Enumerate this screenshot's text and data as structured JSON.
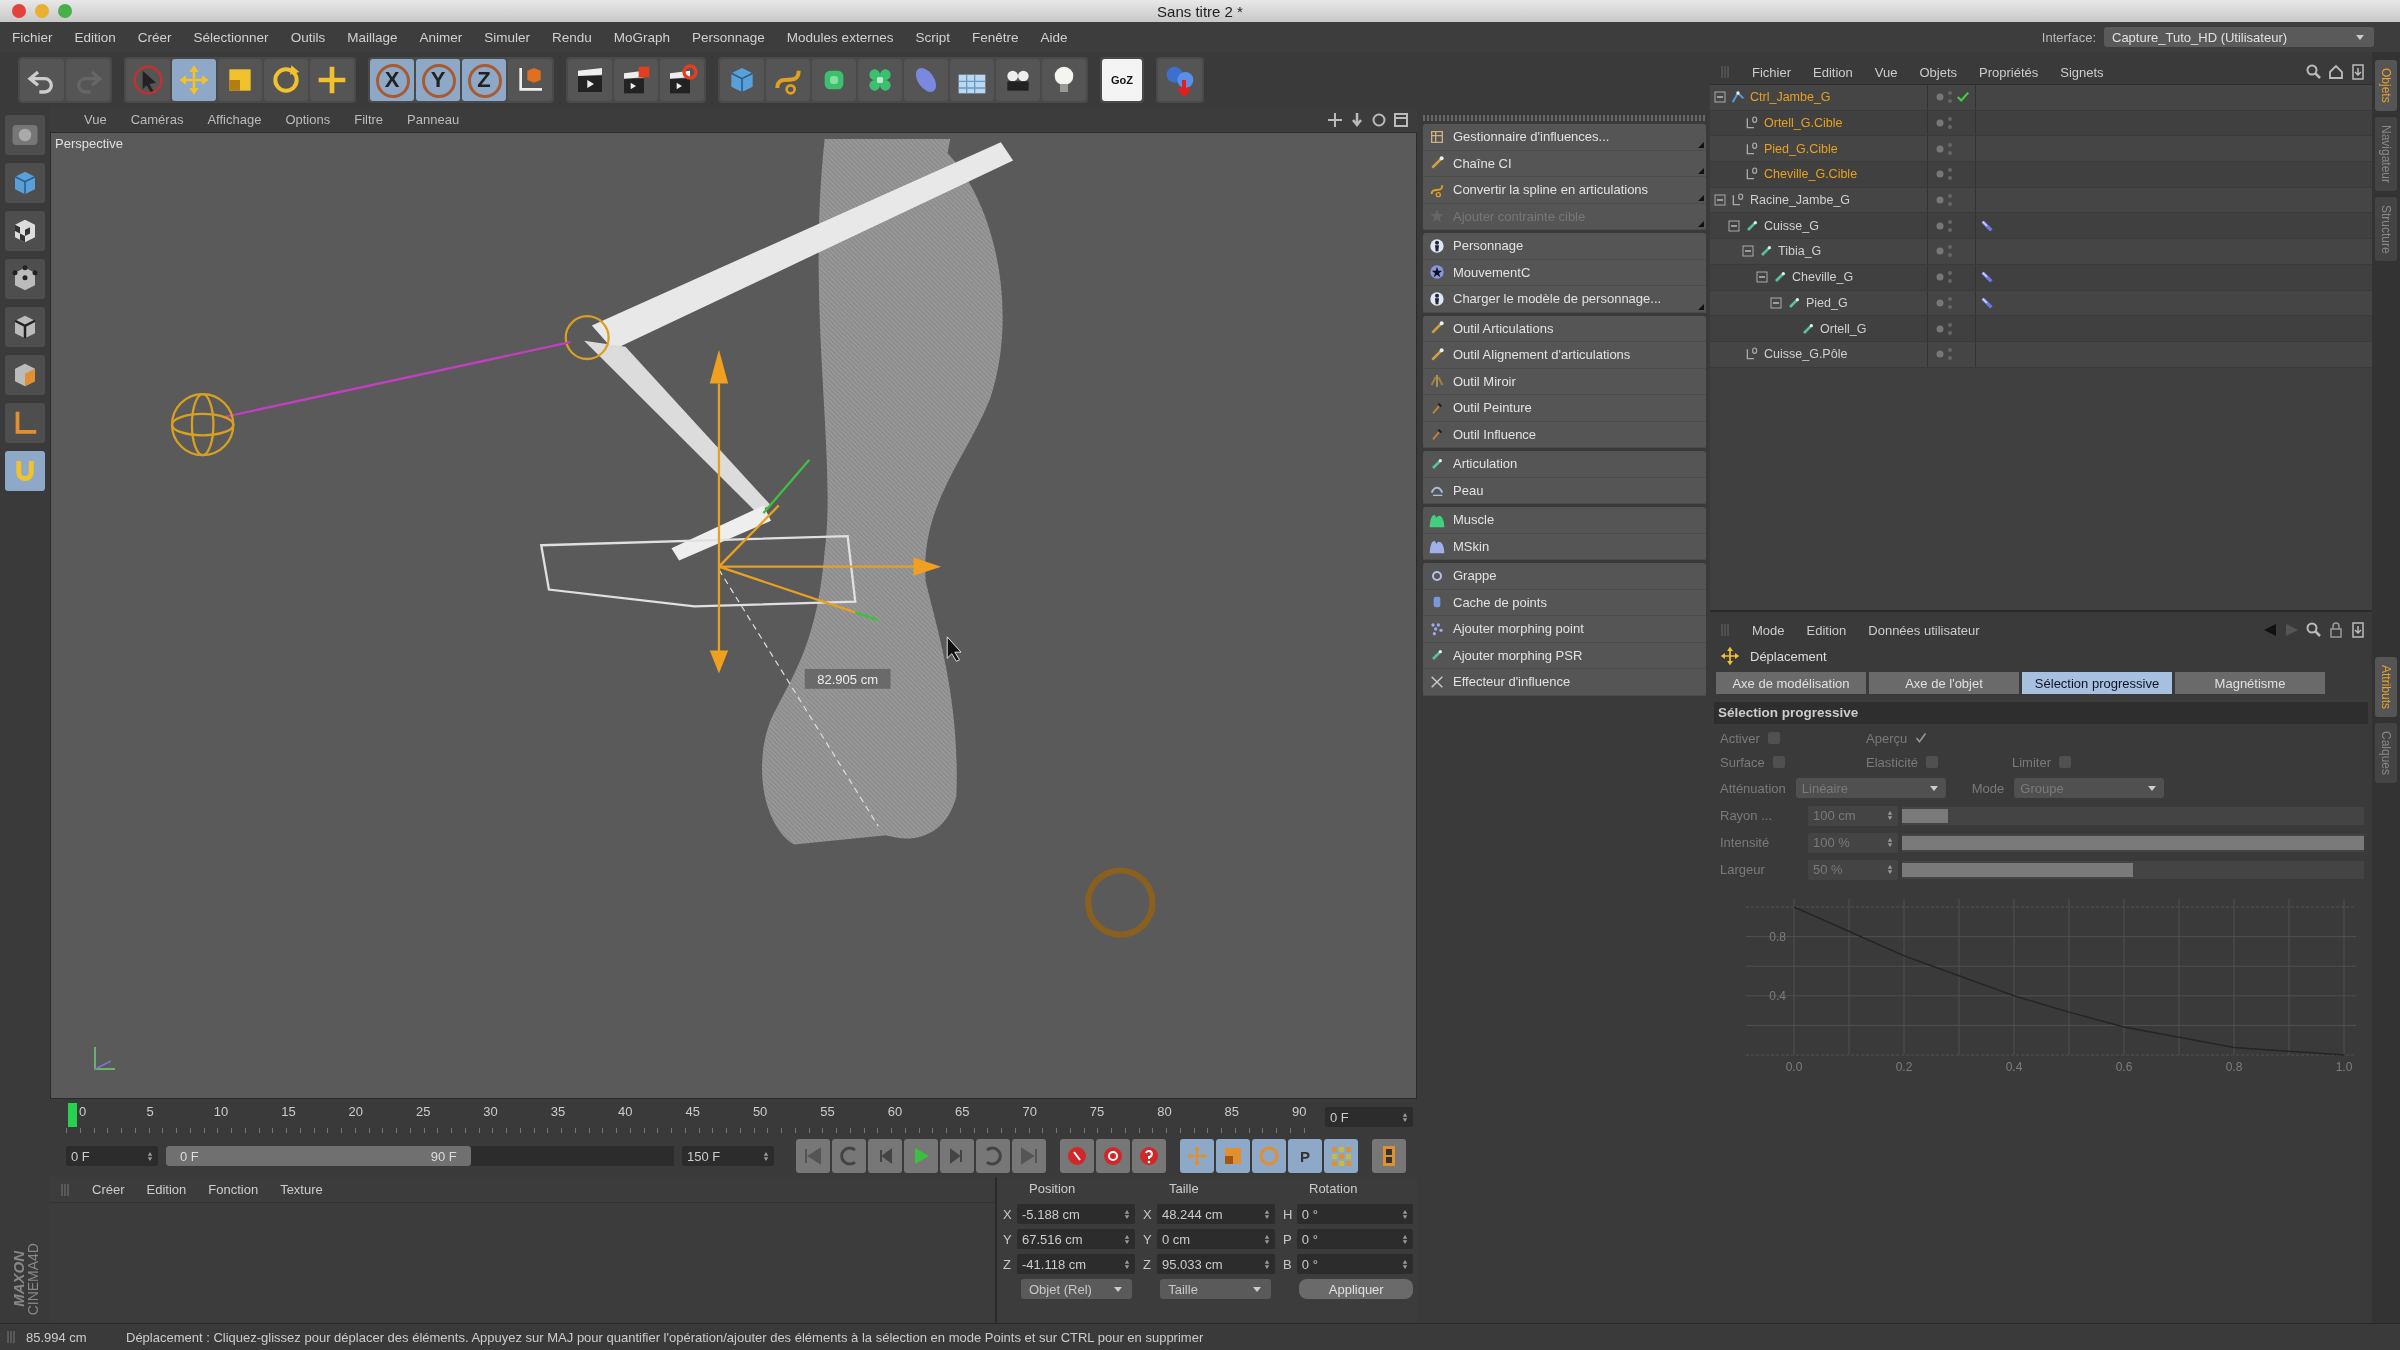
{
  "window": {
    "title": "Sans titre 2 *"
  },
  "menu_bar": {
    "items": [
      "Fichier",
      "Edition",
      "Créer",
      "Sélectionner",
      "Outils",
      "Maillage",
      "Animer",
      "Simuler",
      "Rendu",
      "MoGraph",
      "Personnage",
      "Modules externes",
      "Script",
      "Fenêtre",
      "Aide"
    ],
    "interface_label": "Interface:",
    "interface_value": "Capture_Tuto_HD (Utilisateur)"
  },
  "toolbar": {
    "groups": [
      [
        {
          "kind": "undo",
          "selected": false
        },
        {
          "kind": "redo",
          "selected": false
        }
      ],
      [
        {
          "kind": "pointer",
          "selected": false
        },
        {
          "kind": "move",
          "selected": true
        },
        {
          "kind": "scale",
          "selected": false
        },
        {
          "kind": "rotate",
          "selected": false
        },
        {
          "kind": "plus",
          "selected": false
        }
      ],
      [
        {
          "kind": "axis",
          "label": "X",
          "selected": true
        },
        {
          "kind": "axis",
          "label": "Y",
          "selected": true
        },
        {
          "kind": "axis",
          "label": "Z",
          "selected": true
        },
        {
          "kind": "axes",
          "selected": false
        }
      ],
      [
        {
          "kind": "clapper",
          "selected": false
        },
        {
          "kind": "clapper-square",
          "selected": false
        },
        {
          "kind": "clapper-gear",
          "selected": false
        }
      ],
      [
        {
          "kind": "cube",
          "selected": false
        },
        {
          "kind": "spline",
          "selected": false
        },
        {
          "kind": "nurbs",
          "selected": false
        },
        {
          "kind": "cloner",
          "selected": false
        },
        {
          "kind": "deformer",
          "selected": false
        },
        {
          "kind": "floor",
          "selected": false
        },
        {
          "kind": "camera",
          "selected": false
        },
        {
          "kind": "bulb",
          "selected": false
        }
      ],
      [
        {
          "kind": "tile",
          "label": "GoZ",
          "selected": false
        }
      ],
      [
        {
          "kind": "spheres",
          "selected": false
        }
      ]
    ]
  },
  "tool_column": [
    {
      "kind": "layout",
      "selected": false
    },
    {
      "kind": "cube",
      "selected": false
    },
    {
      "kind": "checker",
      "selected": false
    },
    {
      "kind": "points",
      "selected": false
    },
    {
      "kind": "edges",
      "selected": false
    },
    {
      "kind": "faces",
      "selected": false
    },
    {
      "kind": "corner",
      "selected": false
    },
    {
      "kind": "magnet",
      "selected": true
    }
  ],
  "logo": {
    "brand": "MAXON",
    "product": "CINEMA4D"
  },
  "viewport": {
    "menu": [
      "Vue",
      "Caméras",
      "Affichage",
      "Options",
      "Filtre",
      "Panneau"
    ],
    "camera": "Perspective",
    "measure": "82.905 cm"
  },
  "character_menu": {
    "groups": [
      [
        {
          "label": "Gestionnaire d'influences...",
          "kind": "grid",
          "disabled": false,
          "submenu": true
        },
        {
          "label": "Chaîne CI",
          "kind": "bone",
          "disabled": false,
          "submenu": true
        },
        {
          "label": "Convertir la spline en articulations",
          "kind": "spline",
          "disabled": false,
          "submenu": true
        },
        {
          "label": "Ajouter contrainte cible",
          "kind": "star",
          "disabled": true,
          "submenu": true
        }
      ],
      [
        {
          "label": "Personnage",
          "kind": "figure",
          "disabled": false,
          "submenu": false
        },
        {
          "label": "MouvementC",
          "kind": "star-disc",
          "disabled": false,
          "submenu": false
        },
        {
          "label": "Charger le modèle de personnage...",
          "kind": "figure",
          "disabled": false,
          "submenu": true
        }
      ],
      [
        {
          "label": "Outil Articulations",
          "kind": "bone",
          "disabled": false,
          "submenu": false
        },
        {
          "label": "Outil Alignement d'articulations",
          "kind": "bone",
          "disabled": false,
          "submenu": false
        },
        {
          "label": "Outil Miroir",
          "kind": "mirror",
          "disabled": false,
          "submenu": false
        },
        {
          "label": "Outil Peinture",
          "kind": "brush",
          "disabled": false,
          "submenu": false
        },
        {
          "label": "Outil Influence",
          "kind": "brush",
          "disabled": false,
          "submenu": false
        }
      ],
      [
        {
          "label": "Articulation",
          "kind": "joint",
          "disabled": false,
          "submenu": false
        },
        {
          "label": "Peau",
          "kind": "skin",
          "disabled": false,
          "submenu": false
        }
      ],
      [
        {
          "label": "Muscle",
          "kind": "muscle",
          "disabled": false,
          "submenu": false
        },
        {
          "label": "MSkin",
          "kind": "mskin",
          "disabled": false,
          "submenu": false
        }
      ],
      [
        {
          "label": "Grappe",
          "kind": "ring",
          "disabled": false,
          "submenu": false
        },
        {
          "label": "Cache de points",
          "kind": "cylinder",
          "disabled": false,
          "submenu": false
        },
        {
          "label": "Ajouter morphing point",
          "kind": "dots",
          "disabled": false,
          "submenu": false
        },
        {
          "label": "Ajouter morphing PSR",
          "kind": "joint",
          "disabled": false,
          "submenu": false
        },
        {
          "label": "Effecteur d'influence",
          "kind": "cross",
          "disabled": false,
          "submenu": false
        }
      ]
    ]
  },
  "object_manager": {
    "menu": [
      "Fichier",
      "Edition",
      "Vue",
      "Objets",
      "Propriétés",
      "Signets"
    ],
    "objects": [
      {
        "name": "Ctrl_Jambe_G",
        "kind": "ik",
        "selected": true,
        "expanded": true,
        "checked": true,
        "tagged": false,
        "children": [
          {
            "name": "Ortell_G.Cible",
            "kind": "null",
            "selected": true,
            "checked": false,
            "tagged": false
          },
          {
            "name": "Pied_G.Cible",
            "kind": "null",
            "selected": true,
            "checked": false,
            "tagged": false
          },
          {
            "name": "Cheville_G.Cible",
            "kind": "null",
            "selected": true,
            "checked": false,
            "tagged": false
          }
        ]
      },
      {
        "name": "Racine_Jambe_G",
        "kind": "null",
        "selected": false,
        "expanded": true,
        "checked": false,
        "tagged": false,
        "children": [
          {
            "name": "Cuisse_G",
            "kind": "joint",
            "selected": false,
            "expanded": true,
            "checked": false,
            "tagged": true,
            "children": [
              {
                "name": "Tibia_G",
                "kind": "joint",
                "selected": false,
                "expanded": true,
                "checked": false,
                "tagged": false,
                "children": [
                  {
                    "name": "Cheville_G",
                    "kind": "joint",
                    "selected": false,
                    "expanded": true,
                    "checked": false,
                    "tagged": true,
                    "children": [
                      {
                        "name": "Pied_G",
                        "kind": "joint",
                        "selected": false,
                        "expanded": true,
                        "checked": false,
                        "tagged": true,
                        "children": [
                          {
                            "name": "Ortell_G",
                            "kind": "joint",
                            "selected": false,
                            "checked": false,
                            "tagged": false
                          }
                        ]
                      }
                    ]
                  }
                ]
              }
            ]
          },
          {
            "name": "Cuisse_G.Pôle",
            "kind": "null",
            "selected": false,
            "checked": false,
            "tagged": false
          }
        ]
      }
    ],
    "side_tabs": [
      {
        "label": "Objets",
        "selected": true
      },
      {
        "label": "Navigateur",
        "selected": false
      },
      {
        "label": "Structure",
        "selected": false
      }
    ]
  },
  "attribute_manager": {
    "menu": [
      "Mode",
      "Edition",
      "Données utilisateur"
    ],
    "tool": "Déplacement",
    "tabs": [
      {
        "label": "Axe de modélisation",
        "selected": false
      },
      {
        "label": "Axe de l'objet",
        "selected": false
      },
      {
        "label": "Sélection progressive",
        "selected": true
      },
      {
        "label": "Magnétisme",
        "selected": false
      }
    ],
    "section": {
      "title": "Sélection progressive",
      "disabled": true,
      "checkboxes": [
        [
          {
            "label": "Activer",
            "checked": false
          },
          {
            "label": "Aperçu",
            "checked": true
          }
        ],
        [
          {
            "label": "Surface",
            "checked": false
          },
          {
            "label": "Elasticité",
            "checked": false
          },
          {
            "label": "Limiter",
            "checked": false
          }
        ]
      ],
      "dropdowns": [
        {
          "label": "Atténuation",
          "value": "Linéaire"
        },
        {
          "label": "Mode",
          "value": "Groupe"
        }
      ],
      "sliders": [
        {
          "label": "Rayon ...",
          "value": "100 cm",
          "level": 0.1
        },
        {
          "label": "Intensité",
          "value": "100 %",
          "level": 1
        },
        {
          "label": "Largeur",
          "value": "50 %",
          "level": 0.5
        }
      ]
    },
    "chart_data": {
      "type": "line",
      "grid": true,
      "x": [
        0,
        0.2,
        0.4,
        0.5,
        0.6,
        0.8,
        1
      ],
      "series": [
        {
          "color": "#222222",
          "values": [
            1,
            0.67,
            0.4,
            0.29,
            0.19,
            0.05,
            0
          ]
        }
      ],
      "xlim": [
        0,
        1
      ],
      "ylim": [
        0,
        1
      ],
      "xticks": [
        {
          "value": 0,
          "label": "0.0"
        },
        {
          "value": 0.2,
          "label": "0.2"
        },
        {
          "value": 0.4,
          "label": "0.4"
        },
        {
          "value": 0.6,
          "label": "0.6"
        },
        {
          "value": 0.8,
          "label": "0.8"
        },
        {
          "value": 1,
          "label": "1.0"
        }
      ],
      "yticks": [
        {
          "value": 0.4,
          "label": "0.4"
        },
        {
          "value": 0.8,
          "label": "0.8"
        }
      ]
    },
    "side_tabs": [
      {
        "label": "Attributs",
        "selected": true
      },
      {
        "label": "Calques",
        "selected": false
      }
    ]
  },
  "timeline": {
    "ticks": [
      "0",
      "5",
      "10",
      "15",
      "20",
      "25",
      "30",
      "35",
      "40",
      "45",
      "50",
      "55",
      "60",
      "65",
      "70",
      "75",
      "80",
      "85",
      "90"
    ],
    "level": 0,
    "frame_field": "0 F"
  },
  "playback": {
    "level": 0.6,
    "start": "0 F",
    "range_start": "0 F",
    "range_end": "90 F",
    "end": "150 F",
    "buttons": [
      {
        "kind": "to-start",
        "selected": false
      },
      {
        "kind": "rewind",
        "selected": false
      },
      {
        "kind": "step-back",
        "selected": false
      },
      {
        "kind": "play",
        "selected": false
      },
      {
        "kind": "step-forward",
        "selected": false
      },
      {
        "kind": "cycle",
        "selected": false
      },
      {
        "kind": "to-end",
        "selected": false
      },
      {
        "kind": "record",
        "selected": false
      },
      {
        "kind": "autokey",
        "selected": false
      },
      {
        "kind": "question",
        "selected": false
      },
      {
        "kind": "key-move",
        "selected": true
      },
      {
        "kind": "key-scale",
        "selected": true
      },
      {
        "kind": "key-rotate",
        "selected": true
      },
      {
        "kind": "key-param",
        "label": "P",
        "selected": true
      },
      {
        "kind": "key-grid",
        "selected": true
      },
      {
        "kind": "film",
        "selected": false
      }
    ]
  },
  "material_manager": {
    "menu": [
      "Créer",
      "Edition",
      "Fonction",
      "Texture"
    ]
  },
  "coordinates": {
    "headers": [
      "Position",
      "Taille",
      "Rotation"
    ],
    "rows": [
      [
        {
          "axis": "X",
          "value": "-5.188 cm"
        },
        {
          "axis": "X",
          "value": "48.244 cm"
        },
        {
          "axis": "H",
          "value": "0 °"
        }
      ],
      [
        {
          "axis": "Y",
          "value": "67.516 cm"
        },
        {
          "axis": "Y",
          "value": "0 cm"
        },
        {
          "axis": "P",
          "value": "0 °"
        }
      ],
      [
        {
          "axis": "Z",
          "value": "-41.118 cm"
        },
        {
          "axis": "Z",
          "value": "95.033 cm"
        },
        {
          "axis": "B",
          "value": "0 °"
        }
      ]
    ],
    "dropdowns": [
      "Objet (Rel)",
      "Taille"
    ],
    "apply": "Appliquer"
  },
  "status_bar": {
    "reading": "85.994 cm",
    "message": "Déplacement : Cliquez-glissez pour déplacer des éléments. Appuyez sur MAJ pour quantifier l'opération/ajouter des éléments à la sélection en mode Points et sur CTRL pour en supprimer"
  }
}
